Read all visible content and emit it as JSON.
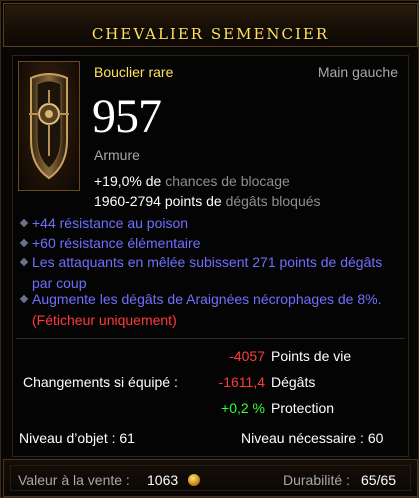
{
  "header": {
    "title": "CHEVALIER SEMENCIER"
  },
  "item": {
    "icon": "shield-icon",
    "type": "Bouclier rare",
    "slot": "Main gauche",
    "armor_value": "957",
    "armor_label": "Armure",
    "block_chance_value": "+19,0% de",
    "block_chance_label": "chances de blocage",
    "blocked_damage_value": "1960-2794 points de",
    "blocked_damage_label": "dégâts bloqués"
  },
  "affixes": [
    {
      "text": "+44 résistance au poison"
    },
    {
      "text": "+60 résistance élémentaire"
    },
    {
      "text": "Les attaquants en mêlée subissent 271 points de dégâts par coup"
    },
    {
      "text": "Augmente les dégâts de Araignées nécrophages de 8%.",
      "restriction": "(Féticheur uniquement)"
    }
  ],
  "changes": {
    "label": "Changements si équipé :",
    "rows": [
      {
        "value": "-4057",
        "name": "Points de vie"
      },
      {
        "value": "-1611,4",
        "name": "Dégâts"
      },
      {
        "value": "+0,2 %",
        "name": "Protection"
      }
    ]
  },
  "levels": {
    "item_level": "Niveau d’objet : 61",
    "required_level": "Niveau nécessaire : 60"
  },
  "footer": {
    "sell_label": "Valeur à la vente :",
    "sell_value": "1063",
    "gold_icon": "gold-coin-icon",
    "durability_label": "Durabilité :",
    "durability_value": "65/65"
  },
  "colors": {
    "title": "#ffe25a",
    "rare": "#ffe25a",
    "magic_affix": "#6f6fff",
    "negative": "#ff3a3a",
    "positive": "#33ff33",
    "muted": "#a8a8a8"
  }
}
